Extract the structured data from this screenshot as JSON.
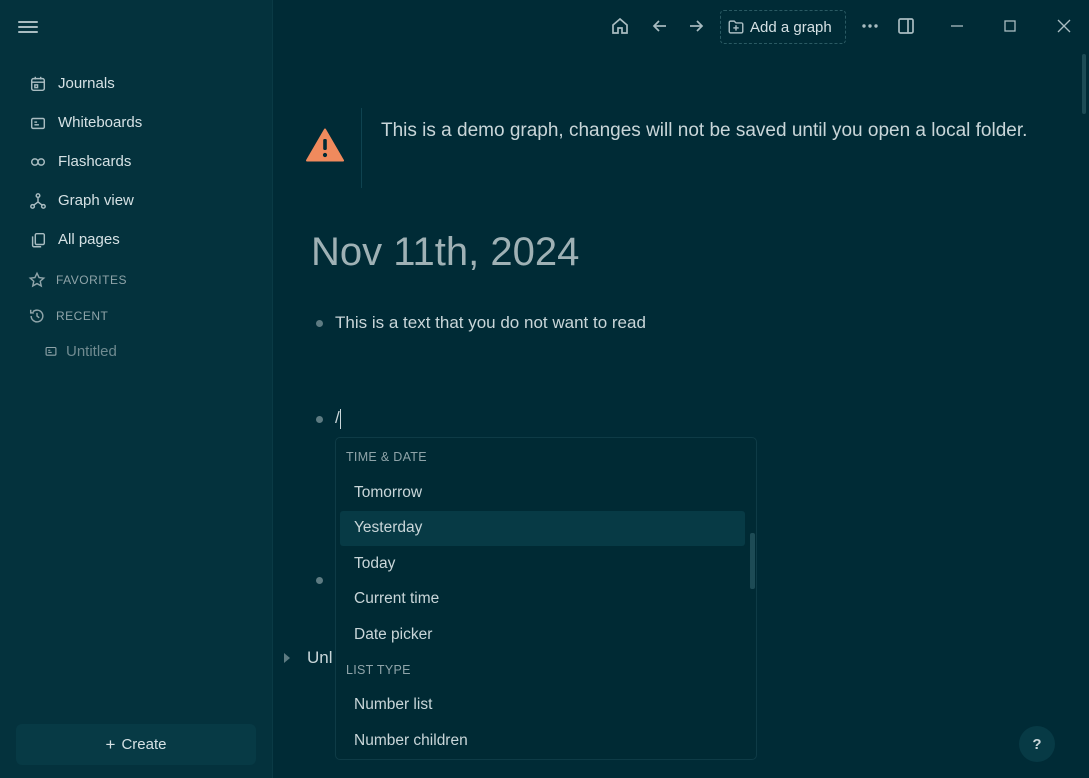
{
  "sidebar": {
    "nav": [
      {
        "label": "Journals",
        "icon": "calendar-icon"
      },
      {
        "label": "Whiteboards",
        "icon": "whiteboard-icon"
      },
      {
        "label": "Flashcards",
        "icon": "infinity-icon"
      },
      {
        "label": "Graph view",
        "icon": "graph-icon"
      },
      {
        "label": "All pages",
        "icon": "pages-icon"
      }
    ],
    "favorites_label": "FAVORITES",
    "recent_label": "RECENT",
    "recent_items": [
      {
        "label": "Untitled",
        "icon": "whiteboard-icon"
      }
    ],
    "create_label": "Create"
  },
  "topbar": {
    "add_graph_label": "Add a graph"
  },
  "warning": {
    "text": "This is a demo graph, changes will not be saved until you open a local folder.",
    "accent": "#f08a5d"
  },
  "page": {
    "title": "Nov 11th, 2024",
    "blocks": [
      {
        "text": "This is a text that you do not want to read"
      },
      {
        "text": "/"
      },
      {
        "text": ""
      }
    ],
    "unlinked_label": "Unl"
  },
  "command_popup": {
    "groups": [
      {
        "label": "TIME & DATE",
        "items": [
          "Tomorrow",
          "Yesterday",
          "Today",
          "Current time",
          "Date picker"
        ]
      },
      {
        "label": "LIST TYPE",
        "items": [
          "Number list",
          "Number children"
        ]
      }
    ],
    "active_item": "Yesterday"
  },
  "help_label": "?",
  "colors": {
    "background": "#002b36",
    "sidebar": "#04323d",
    "text": "#c9d6d9"
  }
}
